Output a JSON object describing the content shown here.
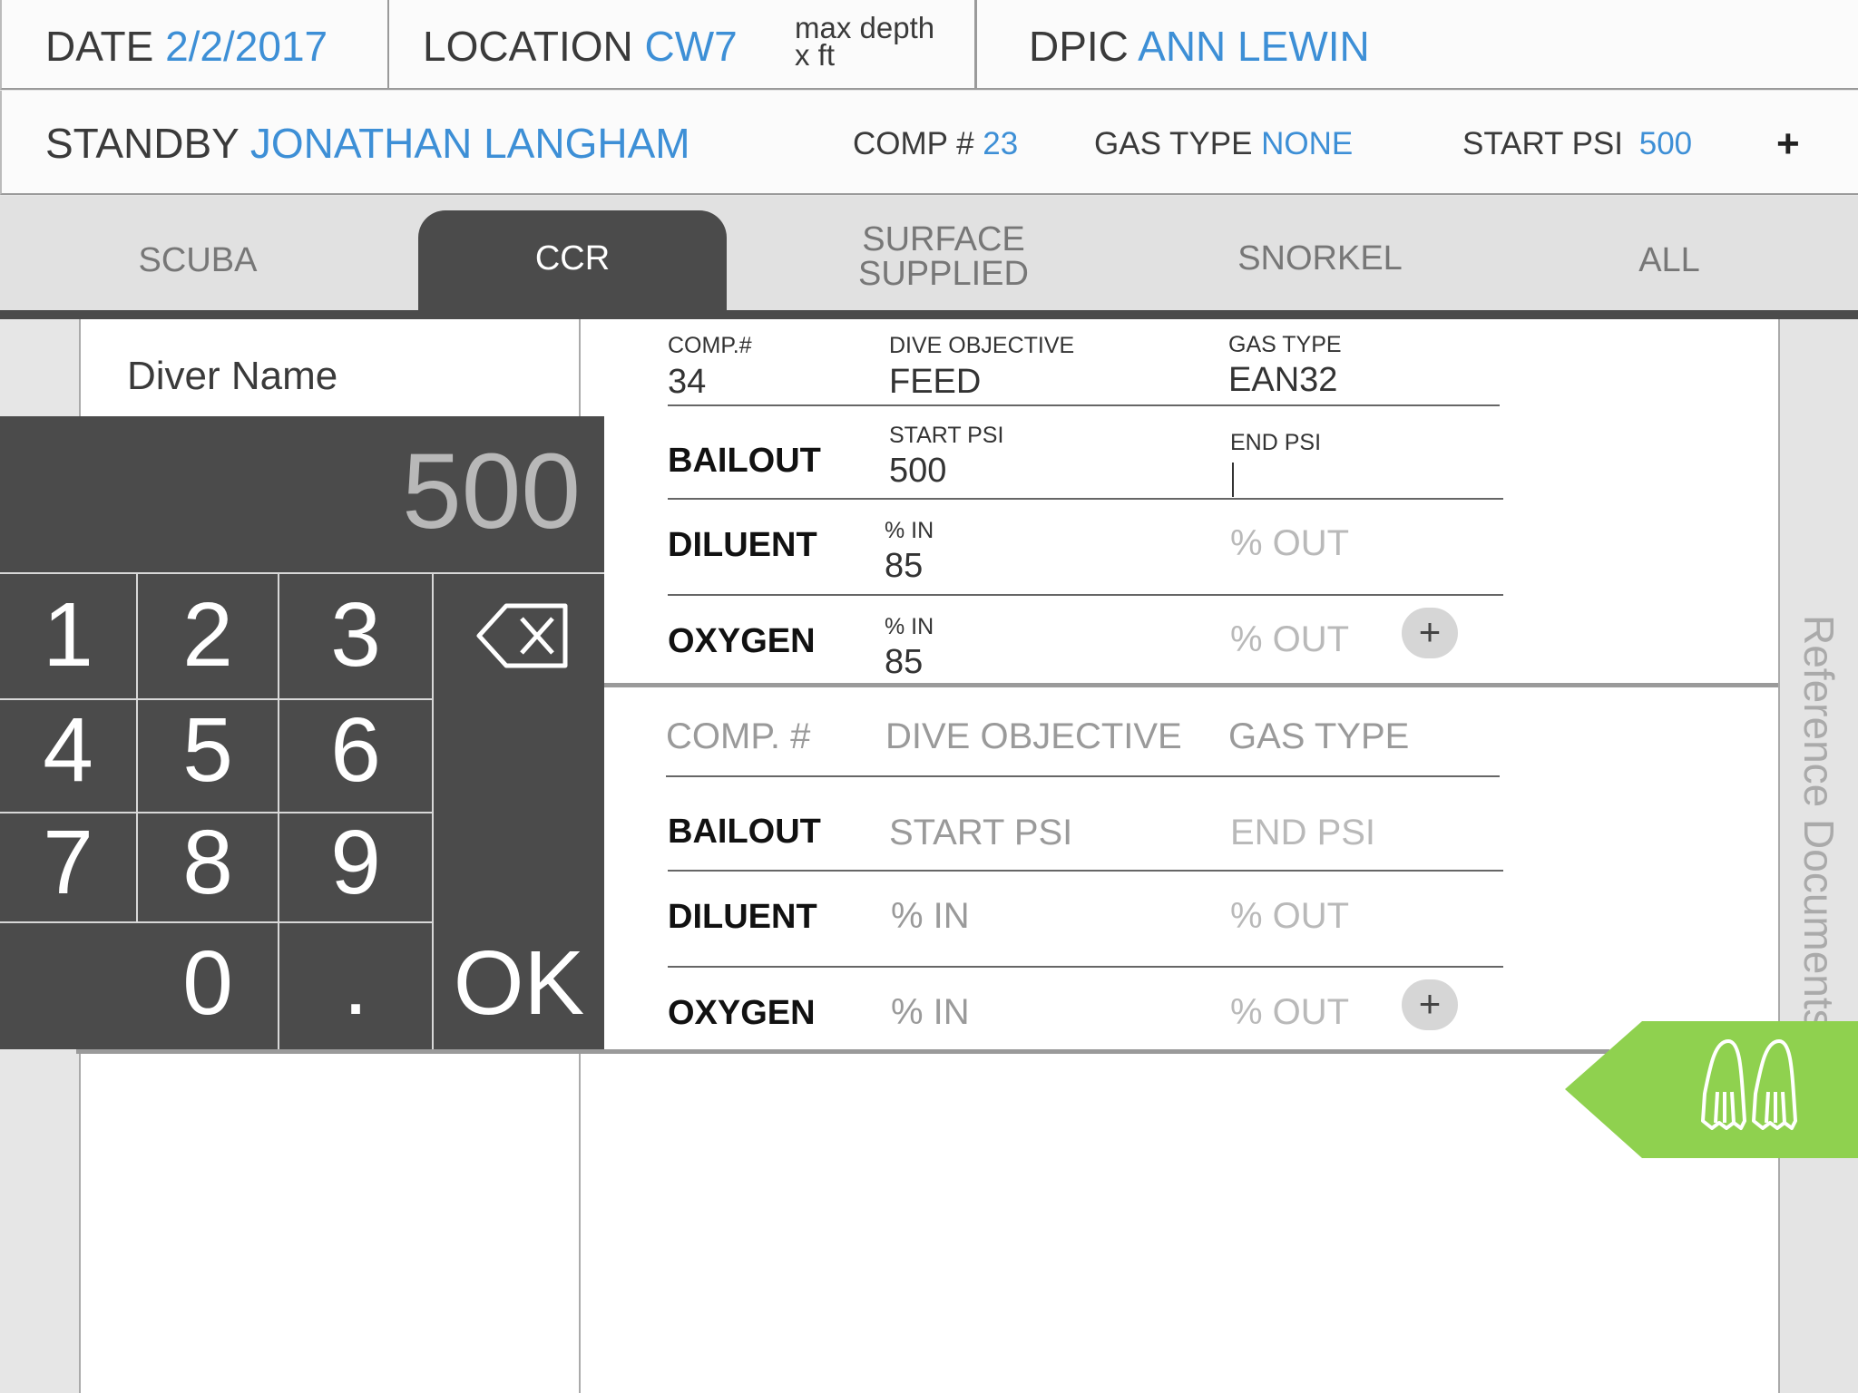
{
  "header": {
    "date_label": "DATE",
    "date_value": "2/2/2017",
    "location_label": "LOCATION",
    "location_value": "CW7",
    "max_depth_line1": "max depth",
    "max_depth_line2": "x ft",
    "dpic_label": "DPIC",
    "dpic_value": "ANN LEWIN",
    "standby_label": "STANDBY",
    "standby_value": "JONATHAN LANGHAM",
    "comp_label": "COMP #",
    "comp_value": "23",
    "gas_label": "GAS TYPE",
    "gas_value": "NONE",
    "start_psi_label": "START PSI",
    "start_psi_value": "500",
    "add_symbol": "+"
  },
  "tabs": {
    "scuba": "SCUBA",
    "ccr": "CCR",
    "surface_line1": "SURFACE",
    "surface_line2": "SUPPLIED",
    "snorkel": "SNORKEL",
    "all": "ALL",
    "active": "CCR"
  },
  "diver": {
    "name_placeholder": "Diver Name"
  },
  "entry1": {
    "comp_label": "COMP.#",
    "comp_value": "34",
    "objective_label": "DIVE OBJECTIVE",
    "objective_value": "FEED",
    "gas_label": "GAS TYPE",
    "gas_value": "EAN32",
    "bailout_label": "BAILOUT",
    "start_psi_label": "START PSI",
    "start_psi_value": "500",
    "end_psi_label": "END PSI",
    "diluent_label": "DILUENT",
    "diluent_in_label": "% IN",
    "diluent_in_value": "85",
    "diluent_out_placeholder": "% OUT",
    "oxygen_label": "OXYGEN",
    "oxygen_in_label": "% IN",
    "oxygen_in_value": "85",
    "oxygen_out_placeholder": "% OUT",
    "add_symbol": "+"
  },
  "entry2": {
    "comp_placeholder": "COMP. #",
    "objective_placeholder": "DIVE OBJECTIVE",
    "gas_placeholder": "GAS TYPE",
    "bailout_label": "BAILOUT",
    "start_psi_placeholder": "START PSI",
    "end_psi_placeholder": "END PSI",
    "diluent_label": "DILUENT",
    "diluent_in_placeholder": "% IN",
    "diluent_out_placeholder": "% OUT",
    "oxygen_label": "OXYGEN",
    "oxygen_in_placeholder": "% IN",
    "oxygen_out_placeholder": "% OUT",
    "add_symbol": "+"
  },
  "keypad": {
    "display": "500",
    "k1": "1",
    "k2": "2",
    "k3": "3",
    "k4": "4",
    "k5": "5",
    "k6": "6",
    "k7": "7",
    "k8": "8",
    "k9": "9",
    "k0": "0",
    "kdot": ".",
    "ok": "OK"
  },
  "sidebar": {
    "reference_label": "Reference Documents"
  },
  "icons": {
    "backspace": "backspace-icon",
    "fins": "fins-icon"
  },
  "colors": {
    "accent_blue": "#3d8fd6",
    "keypad_bg": "#4b4b4b",
    "green_tab": "#8fd14f"
  }
}
